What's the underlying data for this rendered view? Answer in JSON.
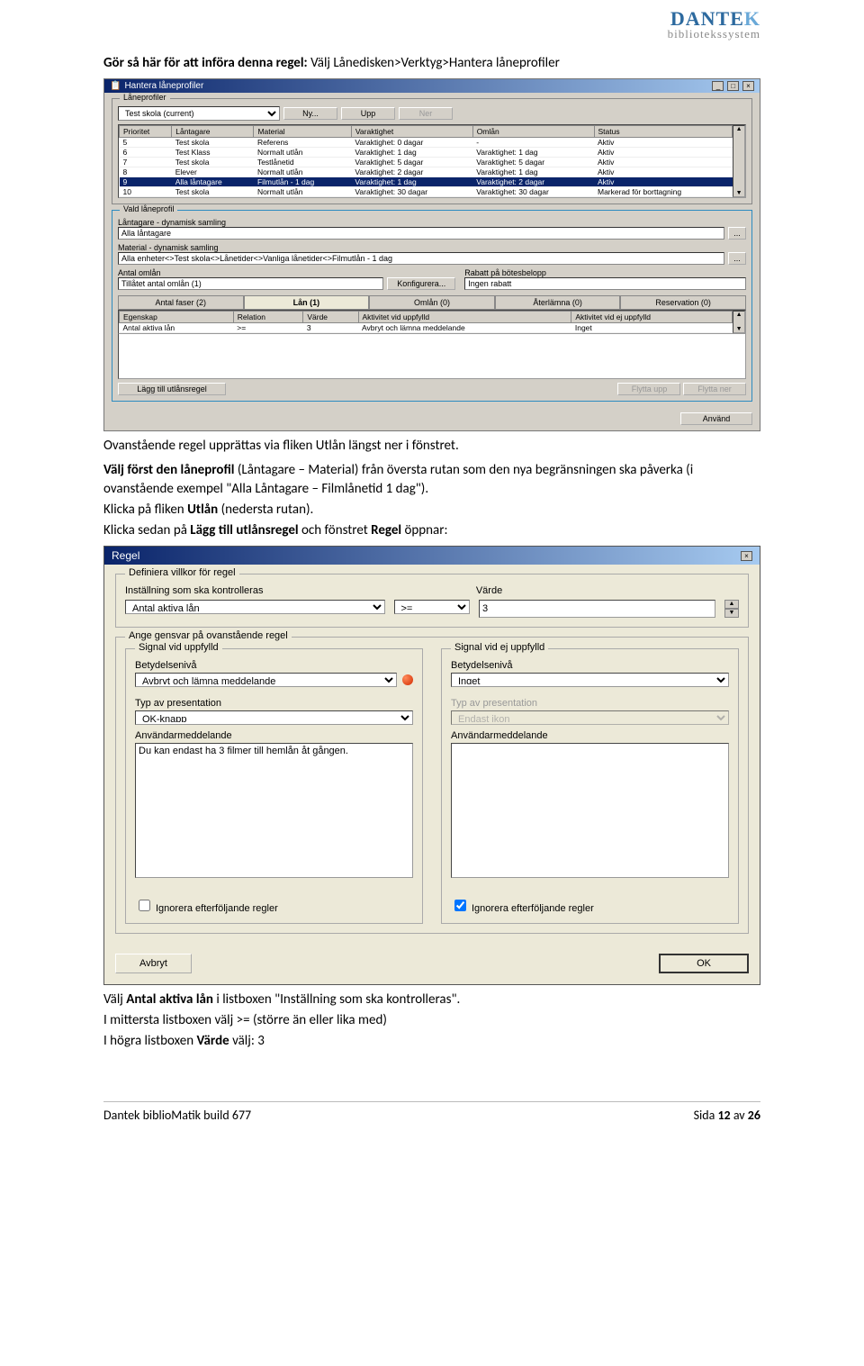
{
  "header": {
    "brand1": "DANTE",
    "brand2": "K",
    "sub": "bibliotekssystem"
  },
  "intro": {
    "lead": "Gör så här för att införa denna regel:",
    "trail": " Välj Lånedisken>Verktyg>Hantera låneprofiler"
  },
  "win1": {
    "title": "Hantera låneprofiler",
    "group_profiles": "Låneprofiler",
    "dropdown_value": "Test skola (current)",
    "btn_ny": "Ny...",
    "btn_upp": "Upp",
    "btn_ner": "Ner",
    "cols": [
      "Prioritet",
      "Låntagare",
      "Material",
      "Varaktighet",
      "Omlån",
      "Status"
    ],
    "rows": [
      [
        "5",
        "Test skola",
        "Referens",
        "Varaktighet: 0 dagar",
        "-",
        "Aktiv"
      ],
      [
        "6",
        "Test Klass",
        "Normalt utlån",
        "Varaktighet: 1 dag",
        "Varaktighet: 1 dag",
        "Aktiv"
      ],
      [
        "7",
        "Test skola",
        "Testlånetid",
        "Varaktighet: 5 dagar",
        "Varaktighet: 5 dagar",
        "Aktiv"
      ],
      [
        "8",
        "Elever",
        "Normalt utlån",
        "Varaktighet: 2 dagar",
        "Varaktighet: 1 dag",
        "Aktiv"
      ],
      [
        "9",
        "Alla låntagare",
        "Filmutlån - 1 dag",
        "Varaktighet: 1 dag",
        "Varaktighet: 2 dagar",
        "Aktiv"
      ],
      [
        "10",
        "Test skola",
        "Normalt utlån",
        "Varaktighet: 30 dagar",
        "Varaktighet: 30 dagar",
        "Markerad för borttagning"
      ]
    ],
    "sel_row": 4,
    "group_vald": "Vald låneprofil",
    "lbl_lantagare": "Låntagare - dynamisk samling",
    "val_lantagare": "Alla låntagare",
    "lbl_material": "Material - dynamisk samling",
    "val_material": "Alla enheter<>Test skola<>Lånetider<>Vanliga lånetider<>Filmutlån - 1 dag",
    "lbl_antal_omlan": "Antal omlån",
    "val_antal_omlan": "Tillåtet antal omlån (1)",
    "btn_konfig": "Konfigurera...",
    "lbl_rabatt": "Rabatt på bötesbelopp",
    "val_rabatt": "Ingen rabatt",
    "tabs": [
      "Antal faser (2)",
      "Lån (1)",
      "Omlån (0)",
      "Återlämna (0)",
      "Reservation (0)"
    ],
    "cols2": [
      "Egenskap",
      "Relation",
      "Värde",
      "Aktivitet vid uppfylld",
      "Aktivitet vid ej uppfylld"
    ],
    "row2": [
      "Antal aktiva lån",
      ">=",
      "3",
      "Avbryt och lämna meddelande",
      "Inget"
    ],
    "btn_lagg": "Lägg till utlånsregel",
    "btn_flytta_upp": "Flytta upp",
    "btn_flytta_ner": "Flytta ner",
    "btn_anvand": "Använd",
    "lookup": "..."
  },
  "mid": {
    "p1": "Ovanstående regel upprättas via fliken Utlån längst ner i fönstret.",
    "p2a": "Välj först den låneprofil",
    "p2b": "  (Låntagare – Material) från översta rutan som den nya begränsningen ska påverka (i ovanstående exempel \"Alla Låntagare – Filmlånetid 1 dag\").",
    "p3a": "Klicka på fliken ",
    "p3b": "Utlån",
    "p3c": " (nedersta rutan).",
    "p4a": "Klicka sedan på ",
    "p4b": "Lägg till utlånsregel",
    "p4c": " och fönstret ",
    "p4d": "Regel",
    "p4e": " öppnar:"
  },
  "regel": {
    "title": "Regel",
    "gb_def": "Definiera villkor för regel",
    "lbl_instal": "Inställning som ska kontrolleras",
    "lbl_varde": "Värde",
    "val_instal": "Antal aktiva lån",
    "val_rel": ">=",
    "val_varde": "3",
    "gb_gensvar": "Ange gensvar på ovanstående regel",
    "gb_sig_upp": "Signal vid uppfylld",
    "gb_sig_ej": "Signal vid ej uppfylld",
    "lbl_niv": "Betydelsenivå",
    "val_niv_upp": "Avbryt och lämna meddelande",
    "val_niv_ej": "Inget",
    "lbl_typ": "Typ av presentation",
    "val_typ_upp": "OK-knapp",
    "val_typ_ej": "Endast ikon",
    "lbl_anv": "Användarmeddelande",
    "msg_upp": "Du kan endast ha 3 filmer till hemlån åt gången.",
    "msg_ej": "",
    "chk_ign": "Ignorera efterföljande regler",
    "btn_avbryt": "Avbryt",
    "btn_ok": "OK"
  },
  "after": {
    "p1a": "Välj ",
    "p1b": "Antal aktiva lån",
    "p1c": " i listboxen \"Inställning som ska kontrolleras\".",
    "p2": "I mittersta listboxen välj  >=   (större än eller lika med)",
    "p3a": "I högra listboxen ",
    "p3b": "Värde",
    "p3c": " välj: 3"
  },
  "footer": {
    "left": "Dantek biblioMatik build 677",
    "right_a": "Sida ",
    "right_b": "12",
    "right_c": " av ",
    "right_d": "26"
  }
}
